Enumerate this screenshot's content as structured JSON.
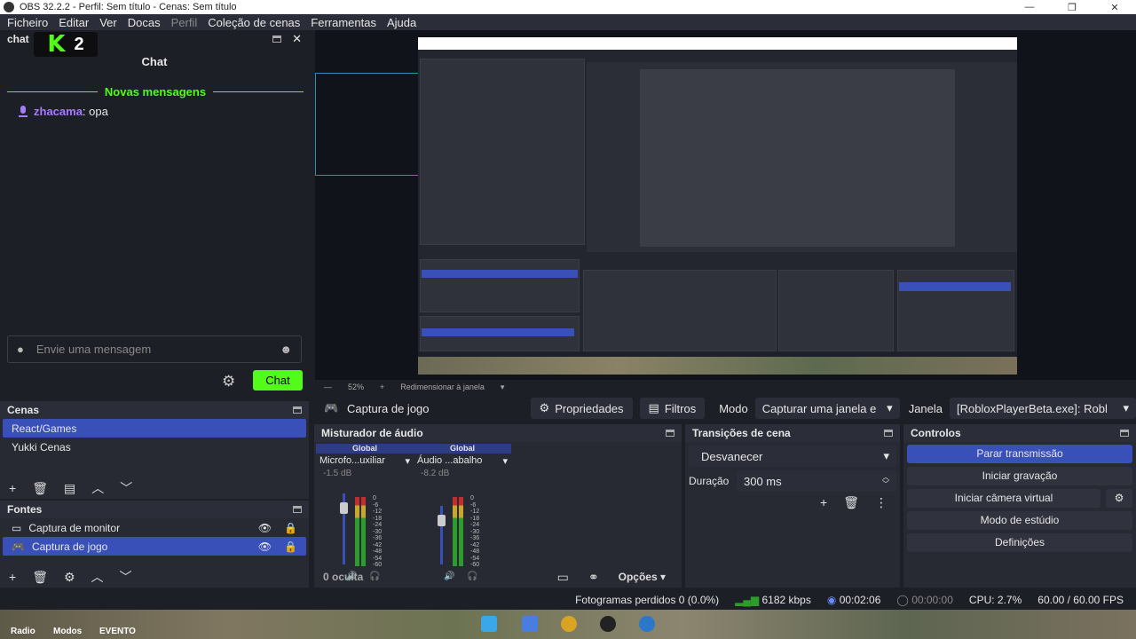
{
  "window": {
    "title": "OBS 32.2.2 - Perfil: Sem título - Cenas: Sem título",
    "minimize": "—",
    "maximize": "❐",
    "close": "✕"
  },
  "menu": [
    "Ficheiro",
    "Editar",
    "Ver",
    "Docas",
    "Perfil",
    "Coleção de cenas",
    "Ferramentas",
    "Ajuda"
  ],
  "chat": {
    "dock_title": "chat",
    "logo_k": "K",
    "logo_num": "2",
    "header": "Chat",
    "new_messages": "Novas mensagens",
    "message_user": "zhacama",
    "message_text": ": opa",
    "input_placeholder": "Envie uma mensagem",
    "send_button": "Chat",
    "accent": "#53fc18"
  },
  "preview": {
    "zoom": "52%",
    "resize_label": "Redimensionar à janela"
  },
  "source_toolbar": {
    "source_name": "Captura de jogo",
    "properties": "Propriedades",
    "filters": "Filtros",
    "mode_label": "Modo",
    "mode_value": "Capturar uma janela e",
    "window_label": "Janela",
    "window_value": "[RobloxPlayerBeta.exe]: Robl"
  },
  "scenes": {
    "title": "Cenas",
    "items": [
      "React/Games",
      "Yukki Cenas"
    ]
  },
  "sources": {
    "title": "Fontes",
    "items": [
      "Captura de monitor",
      "Captura de jogo"
    ]
  },
  "mixer": {
    "title": "Misturador de áudio",
    "hidden": "0 oculta",
    "options": "Opções",
    "channels": [
      {
        "group": "Global",
        "name": "Microfo...uxiliar",
        "db": "-1.5 dB"
      },
      {
        "group": "Global",
        "name": "Áudio ...abalho",
        "db": "-8.2 dB"
      }
    ],
    "scale": [
      "0",
      "-6",
      "-12",
      "-18",
      "-24",
      "-30",
      "-36",
      "-42",
      "-48",
      "-54",
      "-60"
    ]
  },
  "transitions": {
    "title": "Transições de cena",
    "value": "Desvanecer",
    "duration_label": "Duração",
    "duration_value": "300 ms"
  },
  "controls": {
    "title": "Controlos",
    "stop_stream": "Parar transmissão",
    "start_recording": "Iniciar gravação",
    "start_virtual_cam": "Iniciar câmera virtual",
    "studio_mode": "Modo de estúdio",
    "settings": "Definições"
  },
  "status": {
    "dropped_frames": "Fotogramas perdidos 0 (0.0%)",
    "bitrate": "6182 kbps",
    "stream_time": "00:02:06",
    "record_time": "00:00:00",
    "cpu": "CPU: 2.7%",
    "fps": "60.00 / 60.00 FPS"
  },
  "taskbar": {
    "labels": [
      "Radio",
      "Modos",
      "EVENTO"
    ]
  },
  "colors": {
    "accent_blue": "#3950b8",
    "bg": "#1d1f26",
    "panel": "#272a33"
  }
}
